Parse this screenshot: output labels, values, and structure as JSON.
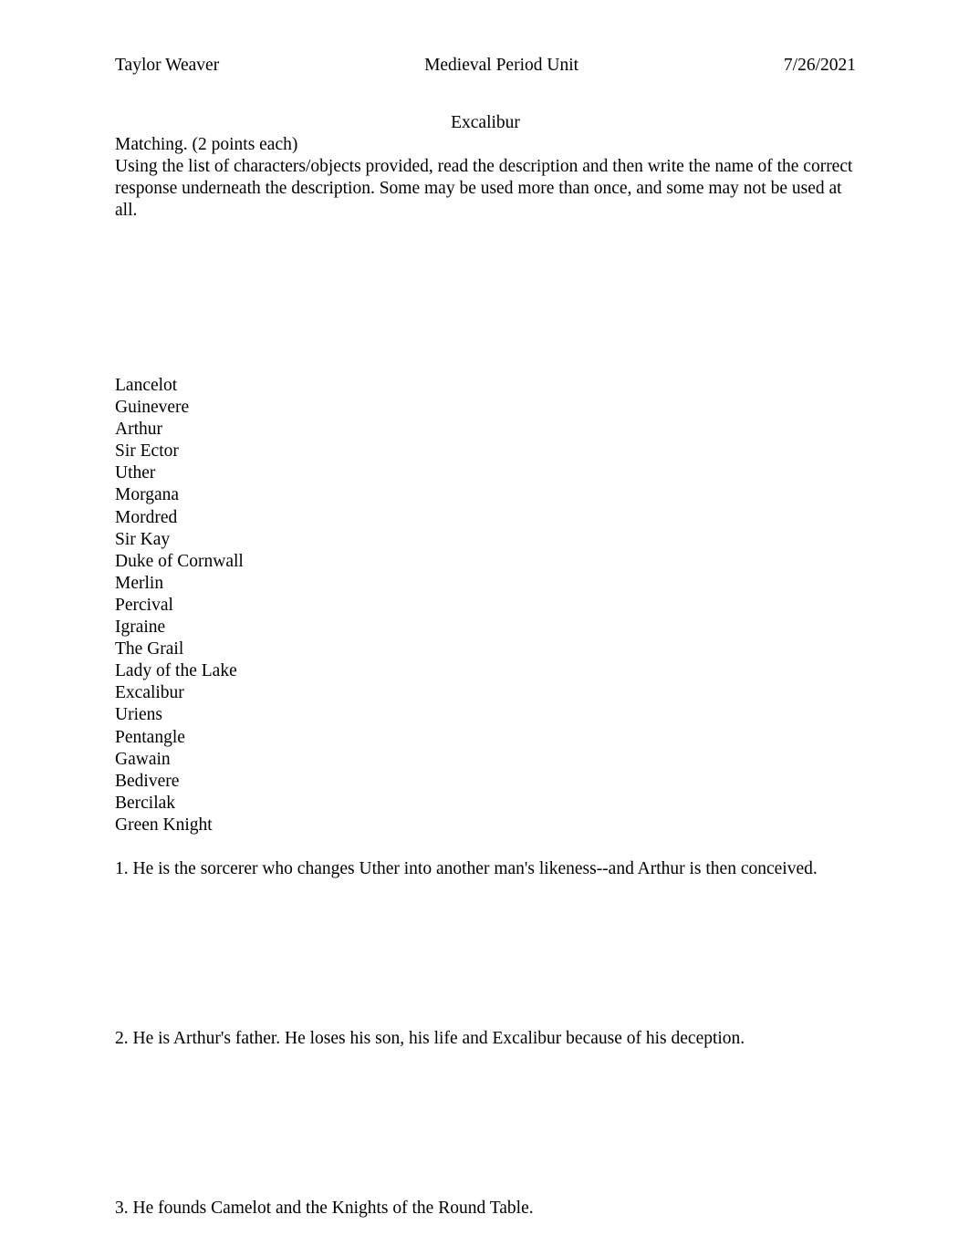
{
  "header": {
    "author": "Taylor Weaver",
    "unit": "Medieval Period Unit",
    "date": "7/26/2021"
  },
  "title": "Excalibur",
  "instructions": {
    "heading": "Matching. (2 points each)",
    "body": "Using the list of characters/objects provided, read the description and then write the name of the correct response underneath the description. Some may be used more than once, and some may not be used at all."
  },
  "word_bank": [
    "Lancelot",
    "Guinevere",
    "Arthur",
    "Sir Ector",
    "Uther",
    "Morgana",
    "Mordred",
    "Sir Kay",
    "Duke of Cornwall",
    "Merlin",
    "Percival",
    "Igraine",
    "The Grail",
    "Lady of the Lake",
    "Excalibur",
    "Uriens",
    "Pentangle",
    "Gawain",
    "Bedivere",
    "Bercilak",
    "Green Knight"
  ],
  "questions": [
    {
      "number": "1.",
      "text": "1. He is the sorcerer who changes Uther into another man's likeness--and Arthur is then conceived."
    },
    {
      "number": "2.",
      "text": "2. He is Arthur's father. He loses his son, his life and Excalibur because of his deception."
    },
    {
      "number": "3.",
      "text": "3. He founds Camelot and the Knights of the Round Table."
    }
  ],
  "colors": {
    "text": "#000000",
    "page_background": "#ffffff"
  }
}
